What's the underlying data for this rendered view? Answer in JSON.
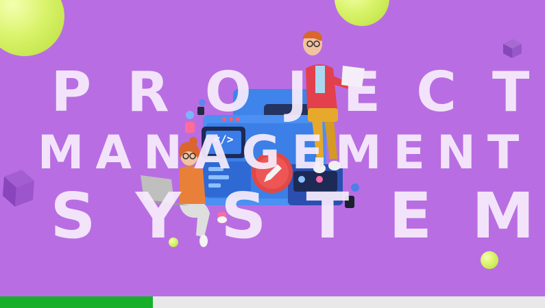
{
  "title": {
    "line1": "PROJECT",
    "line2": "MANAGEMENT",
    "line3": "SYSTEM"
  },
  "colors": {
    "background": "#b86ee2",
    "title_text": "#f6ecfc",
    "accent_ball": "#d9f36a",
    "progress_fill": "#18b02b",
    "progress_track": "#e8e8e8"
  },
  "illustration": {
    "code_icon": "</>"
  },
  "progress": {
    "fraction": 0.28
  }
}
